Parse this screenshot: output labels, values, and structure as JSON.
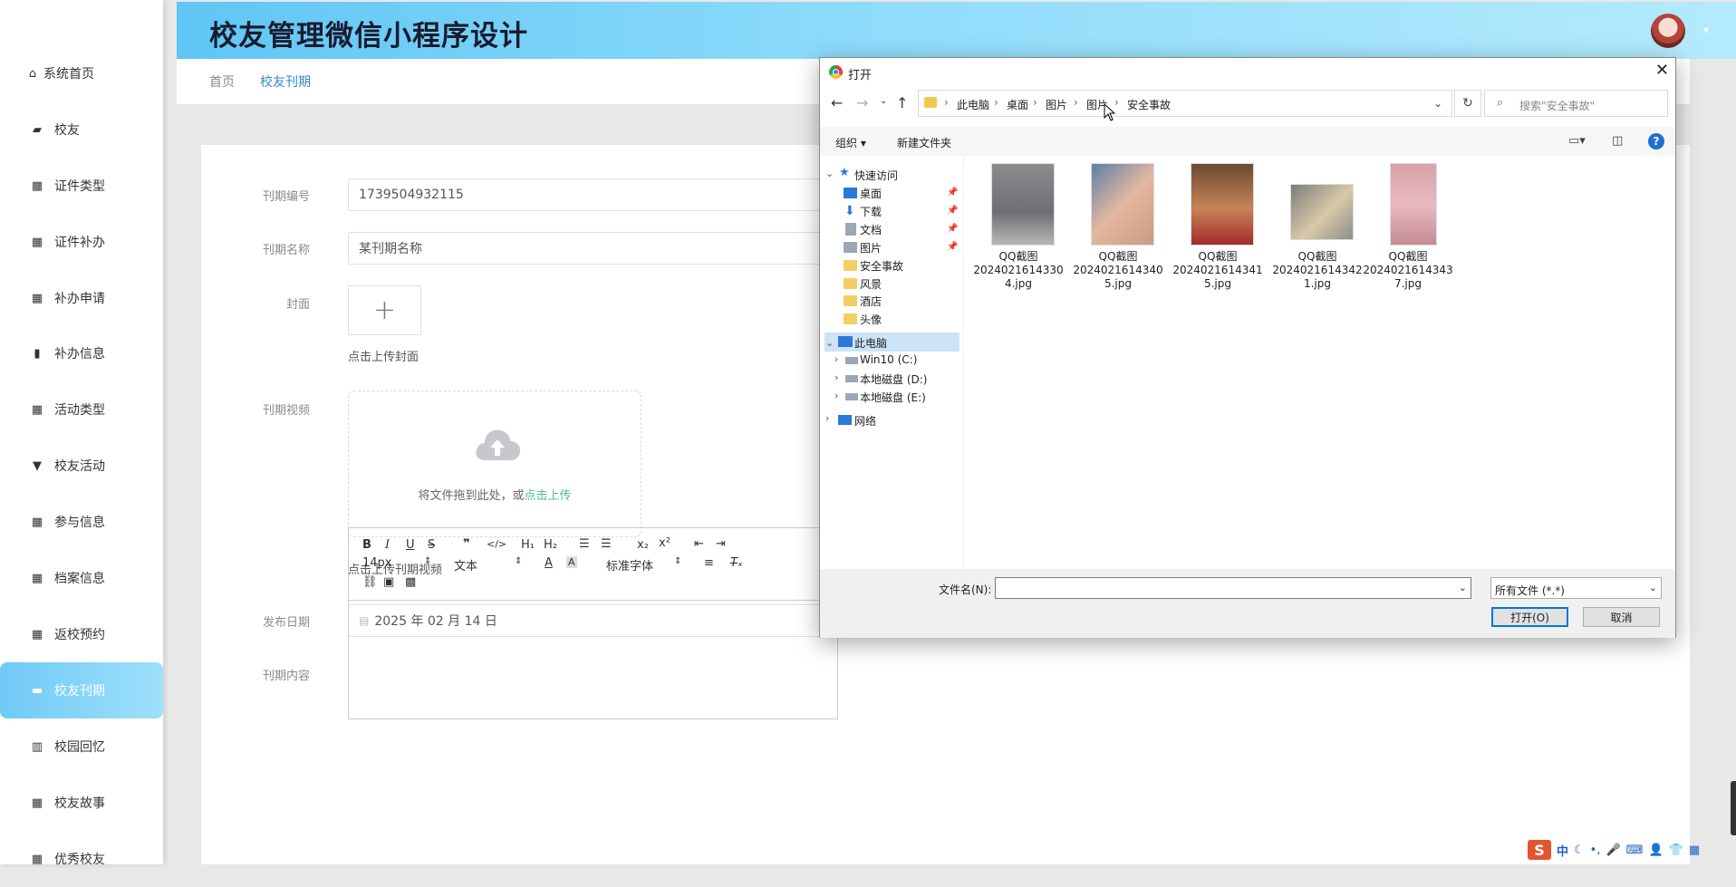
{
  "app": {
    "title": "校友管理微信小程序设计"
  },
  "sidebar": {
    "items": [
      {
        "label": "系统首页",
        "icon": "home-icon",
        "glyph": "⌂"
      },
      {
        "label": "校友",
        "icon": "briefcase-icon",
        "glyph": "▰"
      },
      {
        "label": "证件类型",
        "icon": "grid-icon",
        "glyph": "▦"
      },
      {
        "label": "证件补办",
        "icon": "grid-icon",
        "glyph": "▦"
      },
      {
        "label": "补办申请",
        "icon": "grid-icon",
        "glyph": "▦"
      },
      {
        "label": "补办信息",
        "icon": "bar-chart-icon",
        "glyph": "▮"
      },
      {
        "label": "活动类型",
        "icon": "grid-icon",
        "glyph": "▦"
      },
      {
        "label": "校友活动",
        "icon": "pin-icon",
        "glyph": "▼"
      },
      {
        "label": "参与信息",
        "icon": "grid-icon",
        "glyph": "▦"
      },
      {
        "label": "档案信息",
        "icon": "grid-icon",
        "glyph": "▦"
      },
      {
        "label": "返校预约",
        "icon": "grid-icon",
        "glyph": "▦"
      },
      {
        "label": "校友刊期",
        "icon": "monitor-icon",
        "glyph": "▬"
      },
      {
        "label": "校园回忆",
        "icon": "book-icon",
        "glyph": "▥"
      },
      {
        "label": "校友故事",
        "icon": "apps-icon",
        "glyph": "▦"
      },
      {
        "label": "优秀校友",
        "icon": "grid-icon",
        "glyph": "▦"
      }
    ],
    "active_index": 11
  },
  "breadcrumb": {
    "home": "首页",
    "current": "校友刊期"
  },
  "form": {
    "id_label": "刊期编号",
    "id_value": "1739504932115",
    "name_label": "刊期名称",
    "name_value": "某刊期名称",
    "cover_label": "封面",
    "cover_plus": "+",
    "cover_hint": "点击上传封面",
    "video_label": "刊期视频",
    "video_drop_text": "将文件拖到此处，或",
    "video_drop_link": "点击上传",
    "video_hint": "点击上传刊期视频",
    "date_label": "发布日期",
    "date_value": "2025 年 02 月 14 日",
    "content_label": "刊期内容",
    "editor": {
      "font_size": "14px",
      "text_type": "文本",
      "font_family": "标准字体"
    }
  },
  "dialog": {
    "title": "打开",
    "path": [
      "此电脑",
      "桌面",
      "图片",
      "图片",
      "安全事故"
    ],
    "search_placeholder": "搜索\"安全事故\"",
    "organize": "组织 ▾",
    "new_folder": "新建文件夹",
    "help": "?",
    "tree": {
      "quick_access": "快速访问",
      "quick_items": [
        "桌面",
        "下载",
        "文档",
        "图片",
        "安全事故",
        "风景",
        "酒店",
        "头像"
      ],
      "this_pc": "此电脑",
      "drives": [
        "Win10 (C:)",
        "本地磁盘 (D:)",
        "本地磁盘 (E:)"
      ],
      "network": "网络"
    },
    "files": [
      {
        "line1": "QQ截图",
        "line2": "2024021614330",
        "line3": "4.jpg"
      },
      {
        "line1": "QQ截图",
        "line2": "2024021614340",
        "line3": "5.jpg"
      },
      {
        "line1": "QQ截图",
        "line2": "2024021614341",
        "line3": "5.jpg"
      },
      {
        "line1": "QQ截图",
        "line2": "2024021614342",
        "line3": "1.jpg"
      },
      {
        "line1": "QQ截图",
        "line2": "2024021614343",
        "line3": "7.jpg"
      }
    ],
    "filename_label": "文件名(N):",
    "filetype": "所有文件 (*.*)",
    "open_button": "打开(O)",
    "cancel_button": "取消"
  },
  "ime": {
    "mode": "中"
  },
  "colors": {
    "accent": "#5fc6f5",
    "link": "#2e8bc9",
    "upload_link": "#4cc08a"
  }
}
